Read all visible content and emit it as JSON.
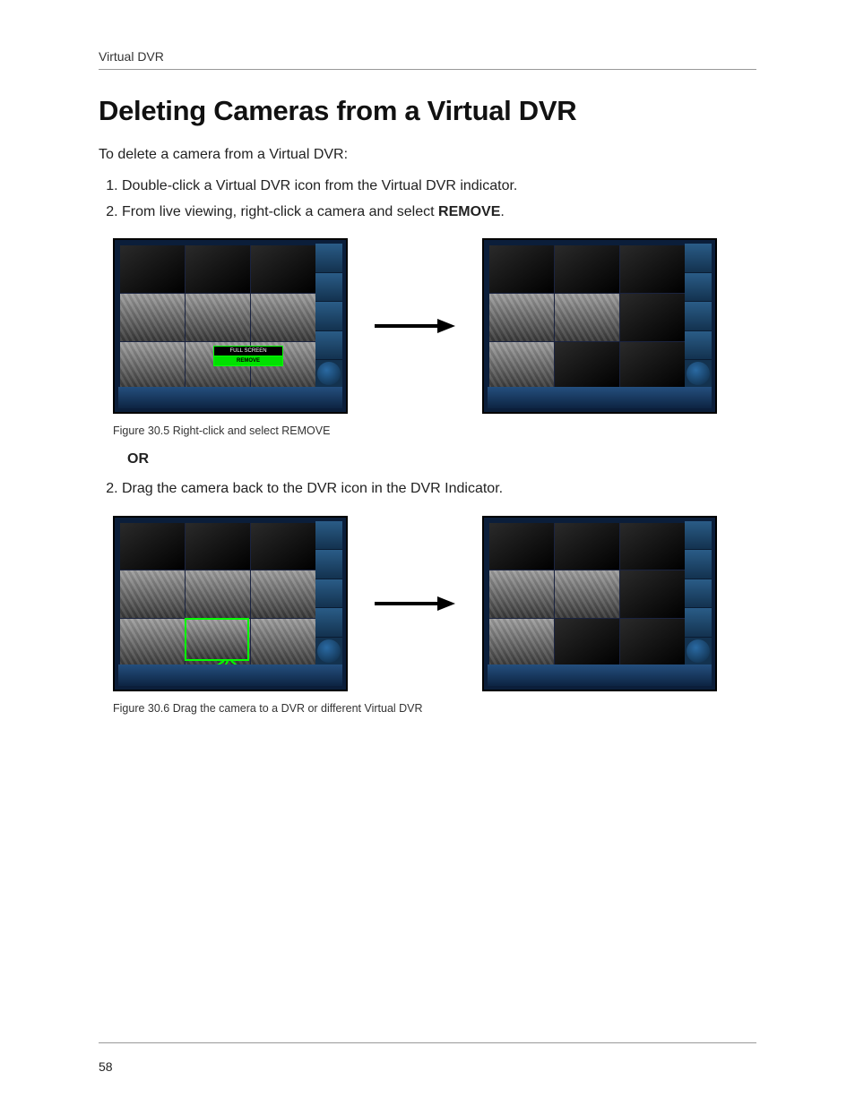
{
  "header": {
    "running_head": "Virtual DVR"
  },
  "title": "Deleting Cameras from a Virtual DVR",
  "intro": "To delete a camera from a Virtual DVR:",
  "steps_a": {
    "item1": "Double-click a Virtual DVR icon from the Virtual DVR indicator.",
    "item2_pre": "From live viewing, right-click a camera and select ",
    "item2_bold": "REMOVE",
    "item2_post": "."
  },
  "context_menu": {
    "full_screen": "FULL SCREEN",
    "remove": "REMOVE"
  },
  "caption1": "Figure 30.5 Right-click and select REMOVE",
  "or_label": "OR",
  "steps_b": {
    "item2": "Drag the camera back to the DVR icon in the DVR Indicator."
  },
  "caption2": "Figure 30.6 Drag the camera to a DVR or different Virtual DVR",
  "footer": {
    "page_number": "58"
  }
}
